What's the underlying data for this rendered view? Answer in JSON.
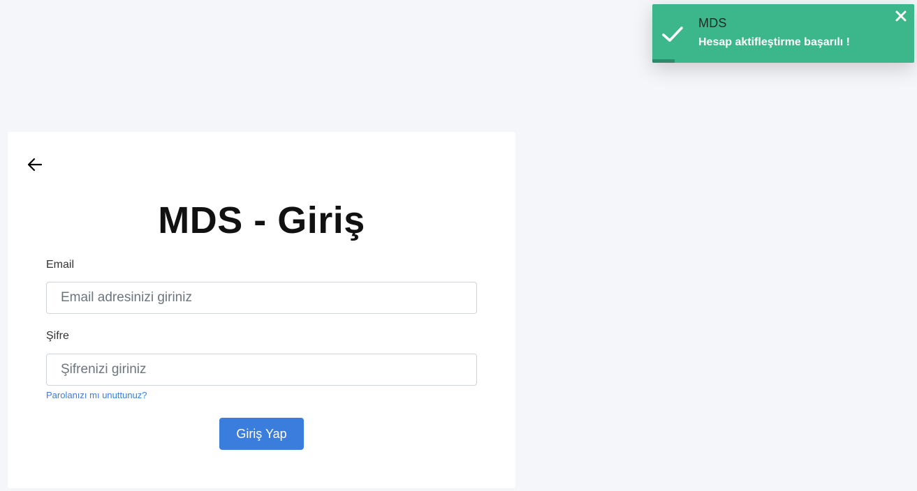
{
  "toast": {
    "title": "MDS",
    "message": "Hesap aktifleştirme başarılı !",
    "progress": 0.085,
    "icon": "check-icon",
    "close_icon": "close-icon",
    "color": "#3bb78b"
  },
  "card": {
    "back_icon": "arrow-left-icon",
    "title": "MDS - Giriş",
    "email": {
      "label": "Email",
      "value": "",
      "placeholder": "Email adresinizi giriniz"
    },
    "password": {
      "label": "Şifre",
      "value": "",
      "placeholder": "Şifrenizi giriniz"
    },
    "forgot_password": "Parolanızı mı unuttunuz?",
    "submit_label": "Giriş Yap",
    "accent": "#3b7ddd"
  }
}
